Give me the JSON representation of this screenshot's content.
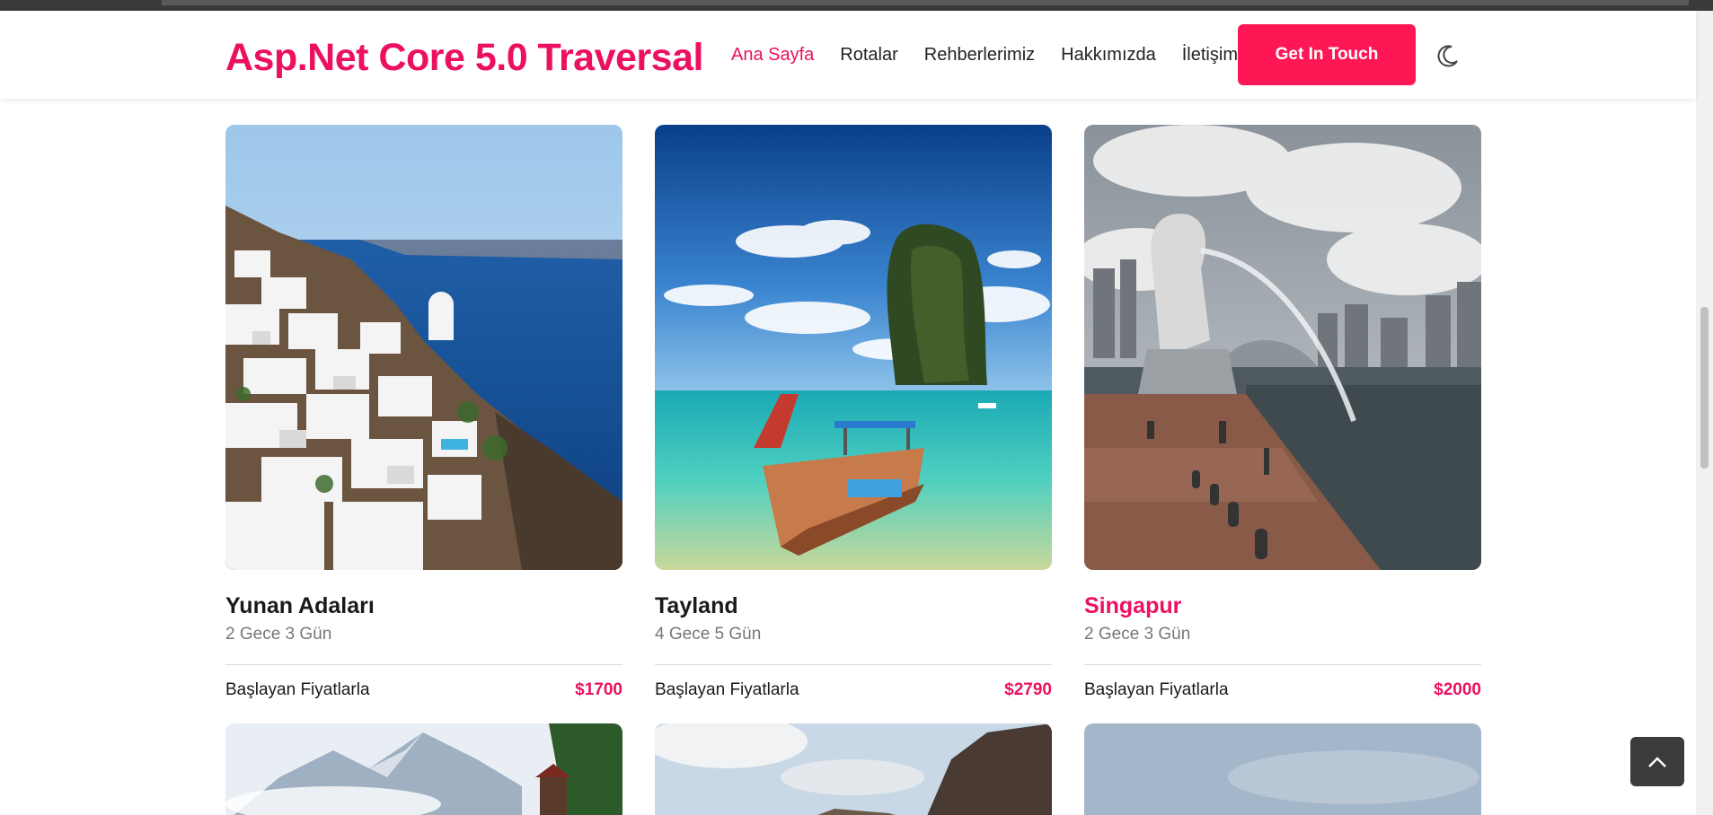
{
  "header": {
    "brand": "Asp.Net Core 5.0 Traversal",
    "nav": [
      {
        "label": "Ana Sayfa",
        "active": true
      },
      {
        "label": "Rotalar",
        "active": false
      },
      {
        "label": "Rehberlerimiz",
        "active": false
      },
      {
        "label": "Hakkımızda",
        "active": false
      },
      {
        "label": "İletişim",
        "active": false
      }
    ],
    "cta_label": "Get In Touch",
    "theme_icon": "moon-icon"
  },
  "tours": [
    {
      "title": "Yunan Adaları",
      "duration": "2 Gece 3 Gün",
      "price_label": "Başlayan Fiyatlarla",
      "price": "$1700",
      "highlight": false
    },
    {
      "title": "Tayland",
      "duration": "4 Gece 5 Gün",
      "price_label": "Başlayan Fiyatlarla",
      "price": "$2790",
      "highlight": false
    },
    {
      "title": "Singapur",
      "duration": "2 Gece 3 Gün",
      "price_label": "Başlayan Fiyatlarla",
      "price": "$2000",
      "highlight": true
    }
  ],
  "colors": {
    "accent": "#ec1060",
    "cta": "#ff1654",
    "back_to_top": "#3b3b3b"
  },
  "back_to_top_icon": "chevron-up-icon"
}
